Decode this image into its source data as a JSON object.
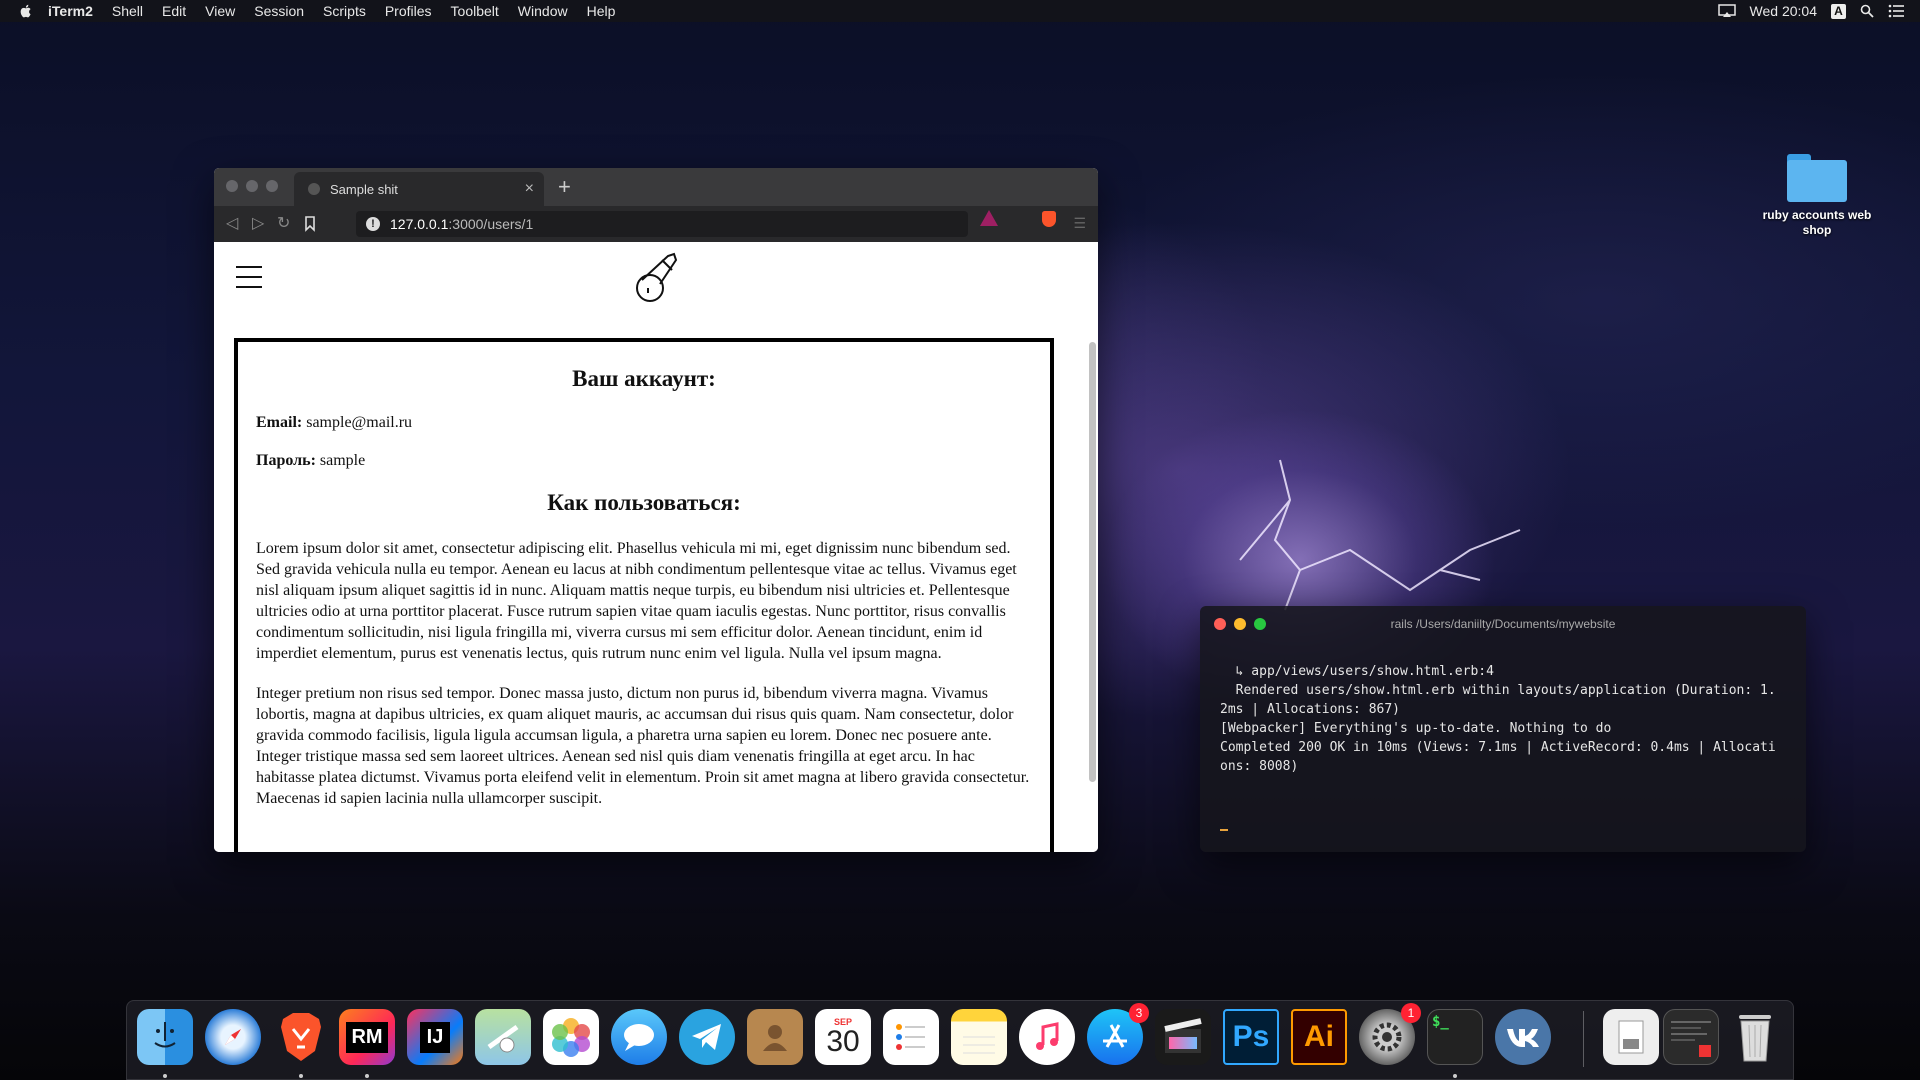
{
  "menubar": {
    "app_name": "iTerm2",
    "items": [
      "Shell",
      "Edit",
      "View",
      "Session",
      "Scripts",
      "Profiles",
      "Toolbelt",
      "Window",
      "Help"
    ],
    "clock": "Wed 20:04",
    "input_source": "A"
  },
  "browser": {
    "tab_title": "Sample shit",
    "url_host": "127.0.0.1",
    "url_path": ":3000/users/1",
    "page": {
      "account_heading": "Ваш аккаунт:",
      "email_label": "Email:",
      "email_value": "sample@mail.ru",
      "password_label": "Пароль:",
      "password_value": "sample",
      "howto_heading": "Как пользоваться:",
      "paragraph_1": "Lorem ipsum dolor sit amet, consectetur adipiscing elit. Phasellus vehicula mi mi, eget dignissim nunc bibendum sed. Sed gravida vehicula nulla eu tempor. Aenean eu lacus at nibh condimentum pellentesque vitae ac tellus. Vivamus eget nisl aliquam ipsum aliquet sagittis id in nunc. Aliquam mattis neque turpis, eu bibendum nisi ultricies et. Pellentesque ultricies odio at urna porttitor placerat. Fusce rutrum sapien vitae quam iaculis egestas. Nunc porttitor, risus convallis condimentum sollicitudin, nisi ligula fringilla mi, viverra cursus mi sem efficitur dolor. Aenean tincidunt, enim id imperdiet elementum, purus est venenatis lectus, quis rutrum nunc enim vel ligula. Nulla vel ipsum magna.",
      "paragraph_2": "Integer pretium non risus sed tempor. Donec massa justo, dictum non purus id, bibendum viverra magna. Vivamus lobortis, magna at dapibus ultricies, ex quam aliquet mauris, ac accumsan dui risus quis quam. Nam consectetur, dolor gravida commodo facilisis, ligula ligula accumsan ligula, a pharetra urna sapien eu lorem. Donec nec posuere ante. Integer tristique massa sed sem laoreet ultrices. Aenean sed nisl quis diam venenatis fringilla at eget arcu. In hac habitasse platea dictumst. Vivamus porta eleifend velit in elementum. Proin sit amet magna at libero gravida consectetur. Maecenas id sapien lacinia nulla ullamcorper suscipit."
    }
  },
  "desktop": {
    "folder_label": "ruby accounts web shop"
  },
  "terminal": {
    "title": "rails /Users/daniilty/Documents/mywebsite",
    "output": "  ↳ app/views/users/show.html.erb:4\n  Rendered users/show.html.erb within layouts/application (Duration: 1.\n2ms | Allocations: 867)\n[Webpacker] Everything's up-to-date. Nothing to do\nCompleted 200 OK in 10ms (Views: 7.1ms | ActiveRecord: 0.4ms | Allocati\nons: 8008)"
  },
  "dock": {
    "calendar_month": "SEP",
    "calendar_day": "30",
    "rubymine_label": "RM",
    "intellij_label": "IJ",
    "photoshop_label": "Ps",
    "illustrator_label": "Ai",
    "appstore_badge": "3",
    "prefs_badge": "1",
    "terminal_label": "$_"
  },
  "colors": {
    "brave_orange": "#fb542b",
    "terminal_cursor": "#e8a33d",
    "badge_red": "#ff2233"
  }
}
